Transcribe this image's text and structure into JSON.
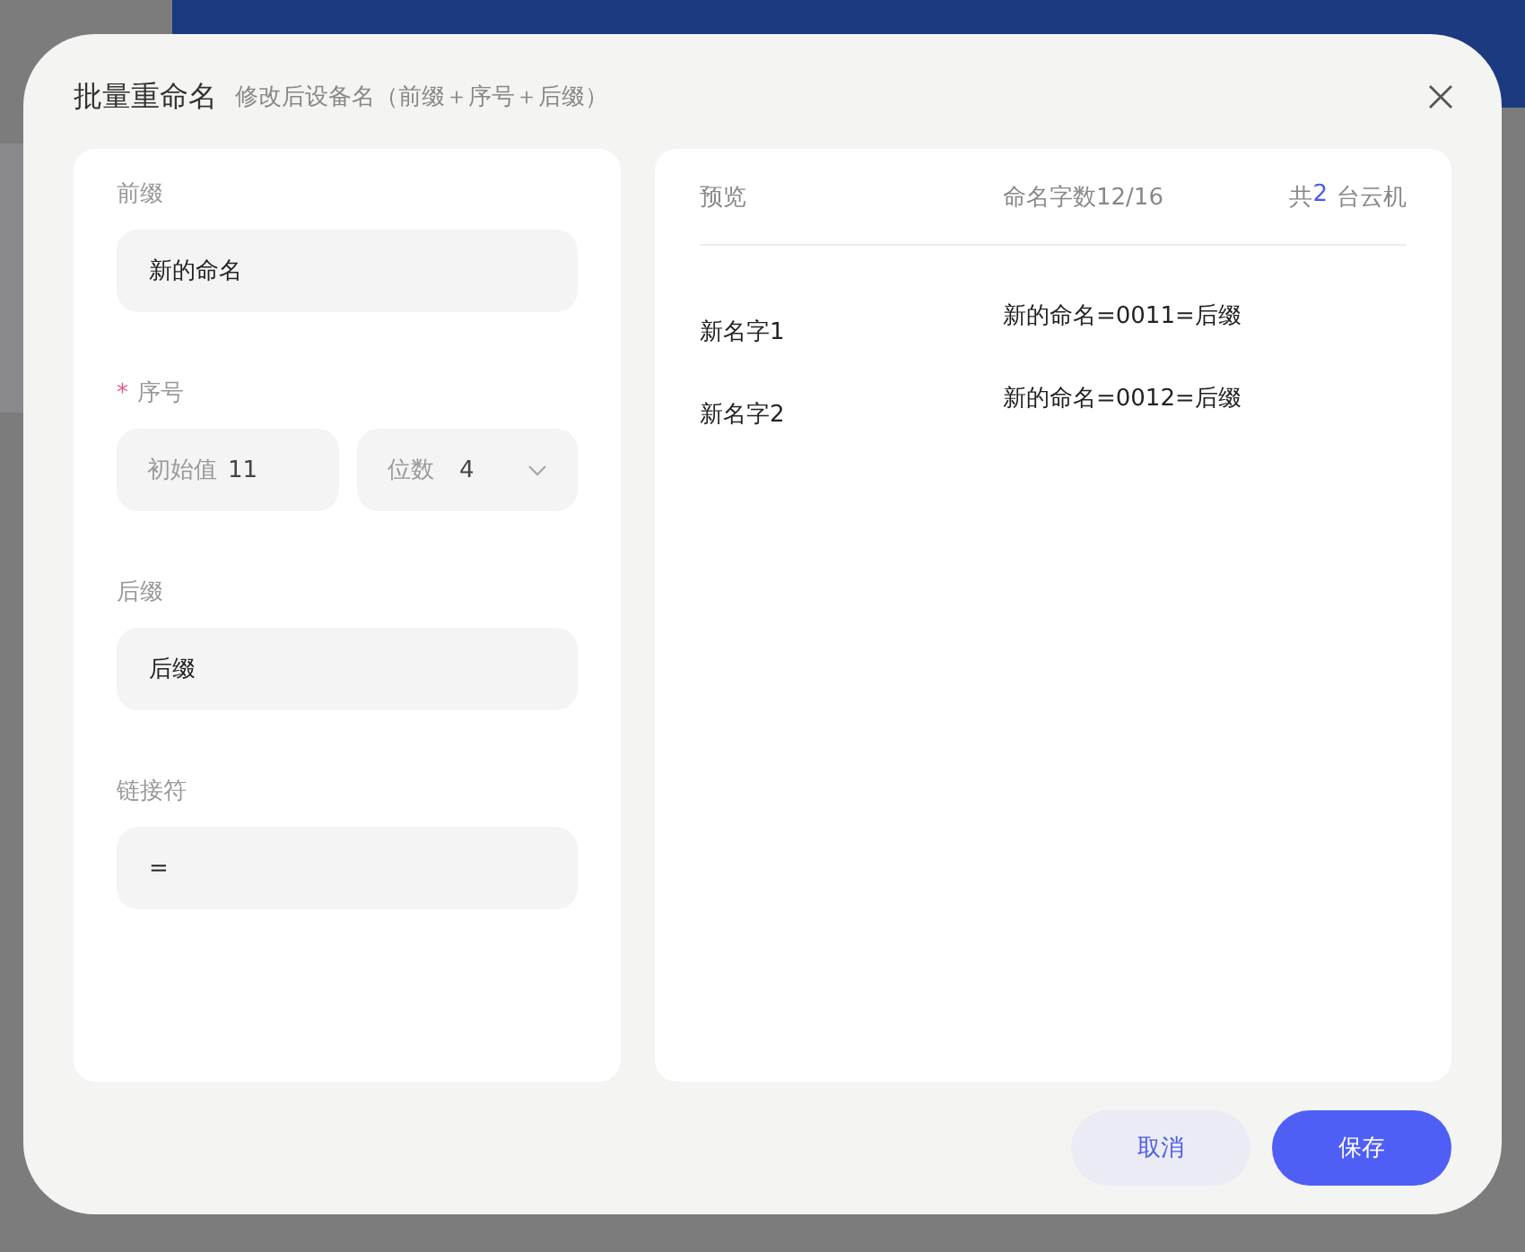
{
  "dialog": {
    "title": "批量重命名",
    "subtitle": "修改后设备名（前缀＋序号＋后缀）"
  },
  "form": {
    "prefix": {
      "label": "前缀",
      "value": "新的命名"
    },
    "serial": {
      "required_mark": "*",
      "label": "序号",
      "start": {
        "label": "初始值",
        "value": "11"
      },
      "digits": {
        "label": "位数",
        "value": "4"
      }
    },
    "suffix": {
      "label": "后缀",
      "value": "后缀"
    },
    "connector": {
      "label": "链接符",
      "value": "="
    }
  },
  "preview": {
    "title": "预览",
    "char_count": "命名字数12/16",
    "total": {
      "prefix": "共",
      "count": "2",
      "suffix": "台云机"
    },
    "rows": [
      {
        "name": "新名字1",
        "result": "新的命名=0011=后缀"
      },
      {
        "name": "新名字2",
        "result": "新的命名=0012=后缀"
      }
    ]
  },
  "buttons": [
    {
      "kind": "secondary",
      "label": "取消"
    },
    {
      "kind": "primary",
      "label": "保存"
    }
  ]
}
